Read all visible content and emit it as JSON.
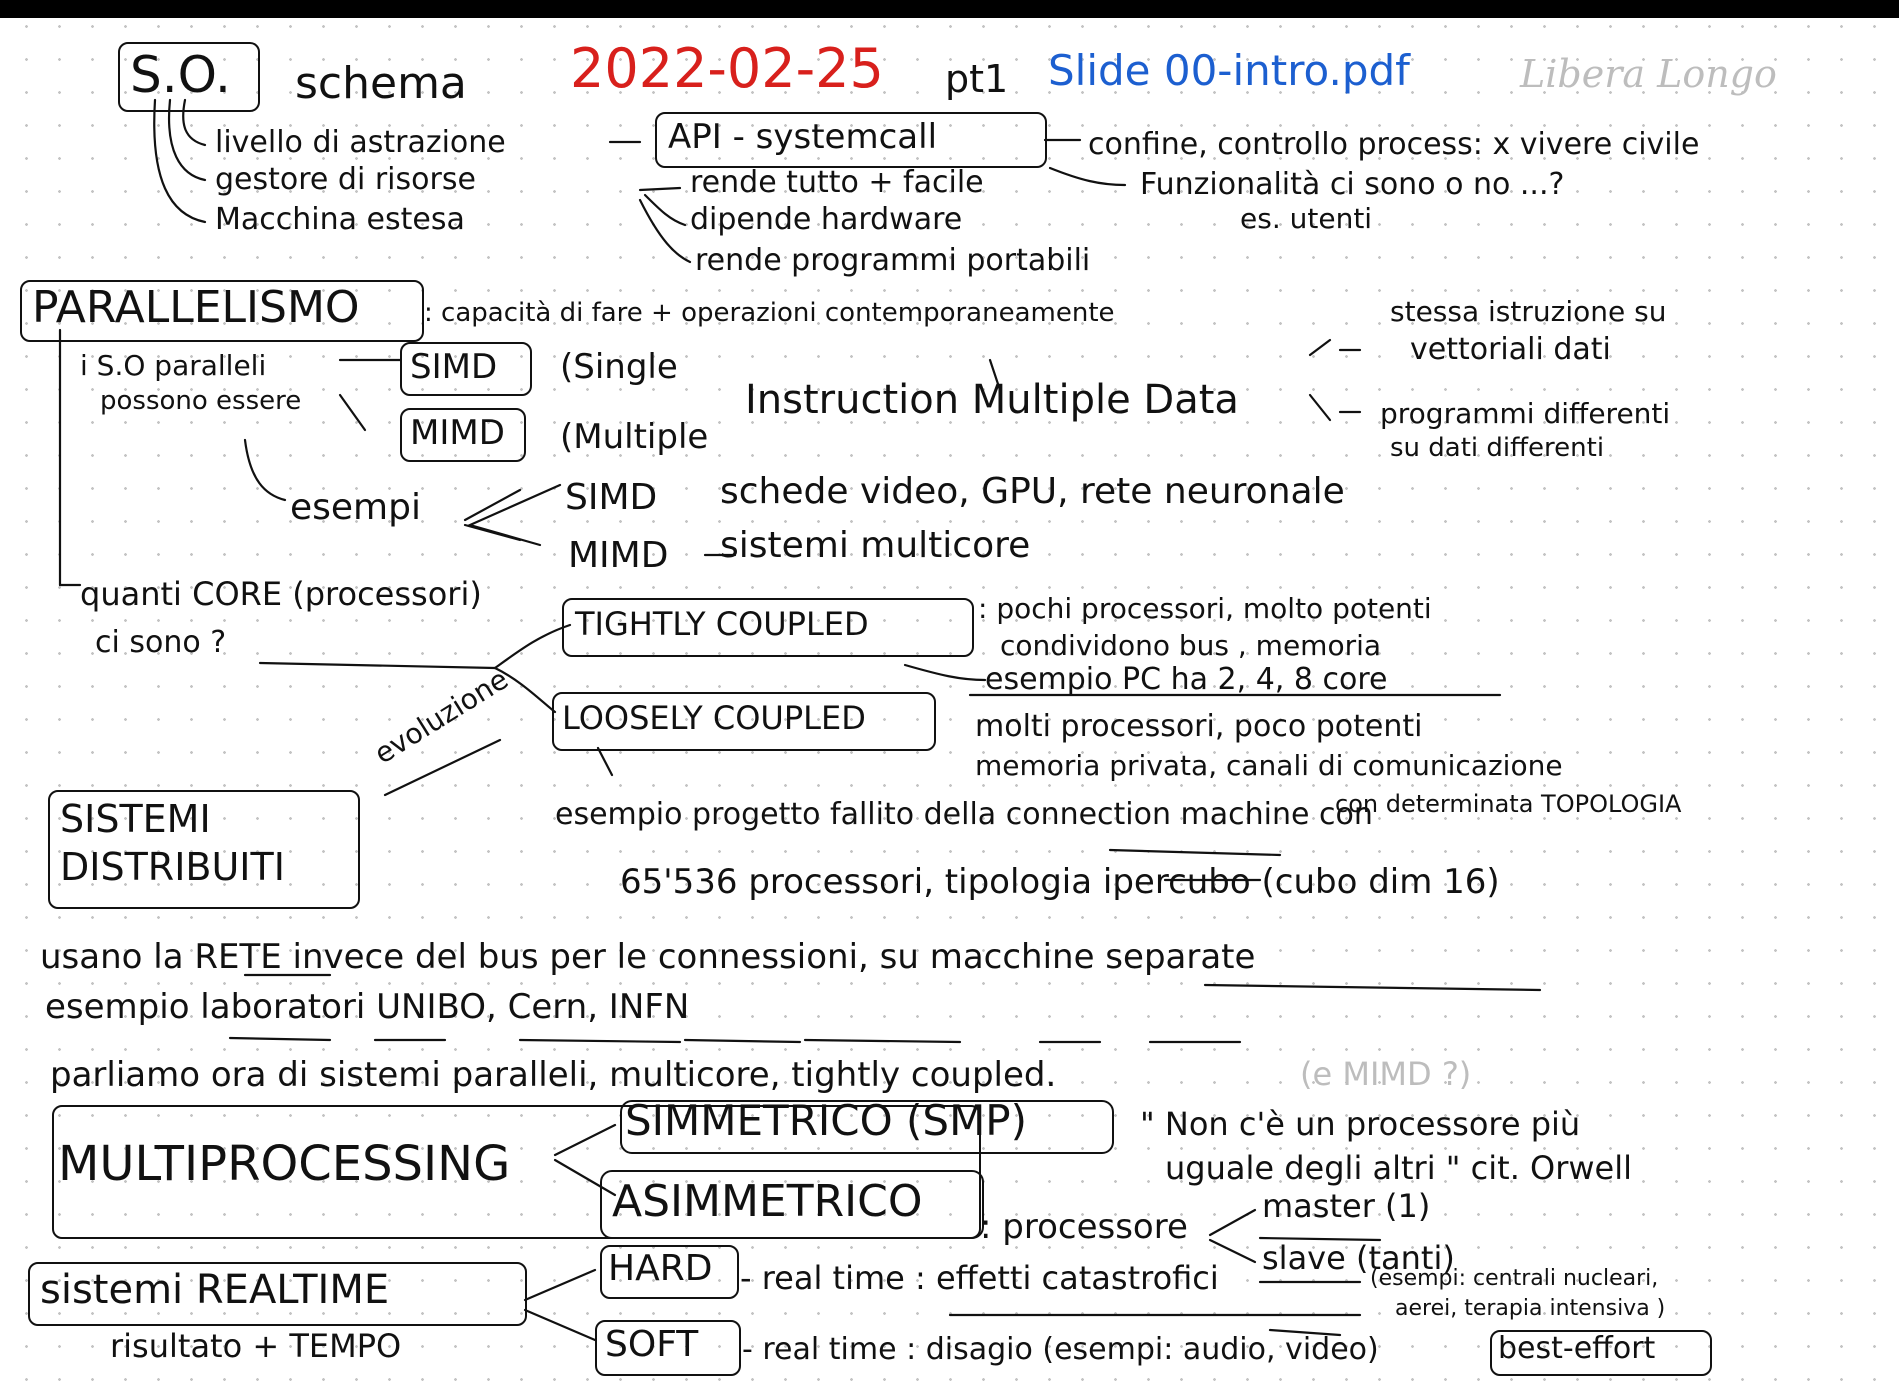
{
  "header": {
    "title_box": "S.O.",
    "title_word": "schema",
    "date": "2022-02-25",
    "part": "pt1",
    "slide_ref": "Slide 00-intro.pdf",
    "author_signature": "Libera Longo",
    "date_color": "#d8201c",
    "slide_color": "#1c5fd0"
  },
  "so_roles": {
    "items": [
      "livello di astrazione",
      "gestore di risorse",
      "Macchina estesa"
    ],
    "api_box": "API - systemcall",
    "api_note_1": "confine, controllo process: x vivere civile",
    "api_note_2": "Funzionalità ci sono o no ...?",
    "api_note_3": "es. utenti",
    "resource_notes": [
      "rende tutto + facile",
      "dipende hardware",
      "rende programmi portabili"
    ]
  },
  "parallelismo": {
    "title": "PARALLELISMO",
    "definition": ": capacità di fare + operazioni contemporaneamente",
    "intro_line1": "i S.O paralleli",
    "intro_line2": "possono essere",
    "simd_box": "SIMD",
    "mimd_box": "MIMD",
    "single": "(Single",
    "multiple": "(Multiple",
    "instruction": "Instruction Multiple Data",
    "simd_note_1": "stessa istruzione su",
    "simd_note_2": "vettoriali dati",
    "mimd_note_1": "programmi differenti",
    "mimd_note_2": "su dati differenti",
    "esempi": "esempi",
    "ex_simd_label": "SIMD",
    "ex_simd_text": "schede video, GPU, rete neuronale",
    "ex_mimd_label": "MIMD",
    "ex_mimd_text": "sistemi multicore"
  },
  "cores": {
    "question_1": "quanti CORE (processori)",
    "question_2": "ci sono ?",
    "tightly_box": "TIGHTLY COUPLED",
    "tightly_note_1": ": pochi processori, molto potenti",
    "tightly_note_2": "condividono bus , memoria",
    "tightly_example": "esempio PC ha 2, 4, 8 core",
    "loosely_box": "LOOSELY COUPLED",
    "loosely_note_1": "molti processori, poco potenti",
    "loosely_note_2": "memoria privata, canali di comunicazione",
    "loosely_note_3": "con determinata TOPOLOGIA",
    "evoluzione": "evoluzione",
    "failed_example_1": "esempio progetto fallito della connection machine con",
    "failed_example_2": "65'536 processori, tipologia ipercubo (cubo dim 16)"
  },
  "distribuiti": {
    "title_1": "SISTEMI",
    "title_2": "DISTRIBUITI",
    "note_1": "usano la RETE invece del bus per le connessioni, su macchine separate",
    "note_2": "esempio laboratori UNIBO, Cern, INFN"
  },
  "multiprocessing": {
    "intro": "parliamo ora di sistemi paralleli, multicore, tightly coupled.",
    "intro_gray": "(e MIMD ?)",
    "title": "MULTIPROCESSING",
    "simmetrico": "SIMMETRICO (SMP)",
    "quote_1": "\" Non c'è un processore più",
    "quote_2": "uguale degli altri \" cit. Orwell",
    "asimmetrico": "ASIMMETRICO",
    "processore": ": processore",
    "master": "master (1)",
    "slave": "slave (tanti)"
  },
  "realtime": {
    "title": "sistemi REALTIME",
    "subtitle": "risultato + TEMPO",
    "hard": "HARD",
    "hard_text": "- real time : effetti catastrofici",
    "hard_examples_1": "(esempi: centrali nucleari,",
    "hard_examples_2": "aerei, terapia intensiva )",
    "soft": "SOFT",
    "soft_text": "- real time : disagio (esempi: audio, video)",
    "best_effort": "best-effort"
  }
}
